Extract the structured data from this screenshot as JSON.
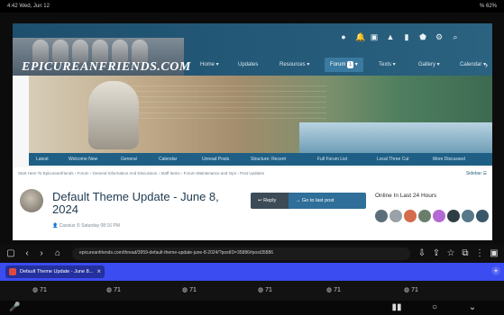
{
  "status_bar": {
    "left": "4:42 Wed, Jun 12",
    "right": "% 62%"
  },
  "site": {
    "logo": "EPICUREANFRIENDS.COM",
    "nav": [
      "Home",
      "Updates",
      "Resources",
      "Forum",
      "Texts",
      "Gallery",
      "Calendar"
    ],
    "forum_badge": "1",
    "top_icons": [
      "user-icon",
      "bell-icon",
      "message-icon",
      "warning-icon",
      "chat-icon",
      "shield-icon",
      "settings-icon",
      "search-icon"
    ],
    "subnav": [
      "Latest",
      "Welcome New",
      "General",
      "Calendar",
      "Unread Posts",
      "Structure: Recent",
      "Full Forum List",
      "Local Three Cut",
      "More Discussed"
    ],
    "breadcrumb": "Start Here To Epicureanfriends › Forum › General Information And Discussion › Staff Items › Forum Maintenance and Ops › Post Updates",
    "breadcrumb_control": "Sidebar ☰",
    "thread": {
      "title": "Default Theme Update - June 8, 2024",
      "author": "Cassius",
      "date": "Saturday 08:16 PM",
      "reply_label": "Reply",
      "go_last_label": "Go to last post"
    },
    "online": {
      "title": "Online In Last 24 Hours"
    }
  },
  "browser": {
    "url": "epicureanfriends.com/thread/3959-default-theme-update-june-8-2024/?postID=35886#post35886",
    "tab_title": "Default Theme Update - June 8..."
  },
  "taskbar": [
    "71",
    "71",
    "71",
    "71",
    "71",
    "71"
  ]
}
